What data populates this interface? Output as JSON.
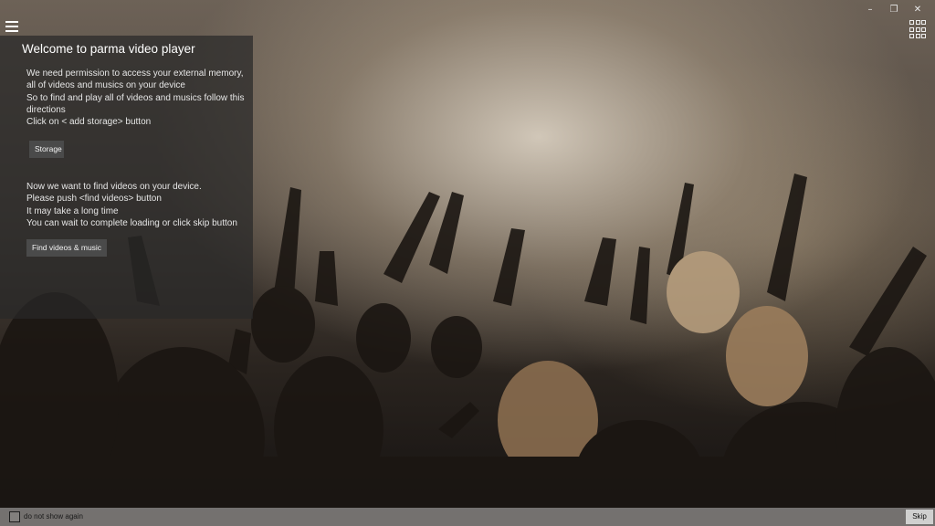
{
  "window": {
    "minimize": "–",
    "restore": "❐",
    "close": "✕"
  },
  "panel": {
    "title": "Welcome to parma video player",
    "paragraph1": [
      "We need permission to access your external memory, all of videos and musics on your device",
      "So to find and play all of videos and musics follow this directions",
      "Click on < add storage> button"
    ],
    "storage_button": "Storage",
    "paragraph2": [
      "Now we want to find videos on your device.",
      "Please push <find videos> button",
      "It may take a long time",
      "You can wait to complete loading or click skip button"
    ],
    "find_button": "Find videos & music"
  },
  "bottom": {
    "checkbox_label": "do not show again",
    "skip": "Skip"
  },
  "icons": {
    "menu": "hamburger-menu-icon",
    "view": "grid-view-icon"
  }
}
